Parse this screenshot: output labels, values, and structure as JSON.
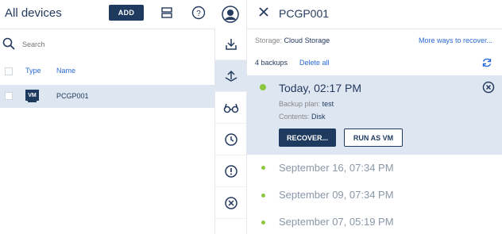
{
  "header": {
    "title": "All devices",
    "add_label": "ADD"
  },
  "search": {
    "placeholder": "Search"
  },
  "table": {
    "columns": [
      "Type",
      "Name"
    ],
    "rows": [
      {
        "type_badge": "VM",
        "name": "PCGP001"
      }
    ]
  },
  "actions": {
    "icons": [
      "recovery-icon",
      "backup-icon",
      "glasses-icon",
      "clock-icon",
      "alert-icon",
      "cancel-icon"
    ]
  },
  "panel": {
    "title": "PCGP001",
    "storage_label": "Storage:",
    "storage_value": "Cloud Storage",
    "more_ways": "More ways to recover...",
    "backup_count": "4 backups",
    "delete_all": "Delete all",
    "selected": {
      "title": "Today, 02:17 PM",
      "plan_label": "Backup plan:",
      "plan_value": "test",
      "contents_label": "Contents:",
      "contents_value": "Disk",
      "recover_label": "RECOVER...",
      "run_vm_label": "RUN AS VM"
    },
    "others": [
      "September 16, 07:34 PM",
      "September 09, 07:34 PM",
      "September 07, 05:19 PM"
    ]
  },
  "colors": {
    "accent": "#1f3a5f",
    "link": "#2a6ad8",
    "selection": "#dde6f1",
    "dot": "#8cc63f"
  }
}
